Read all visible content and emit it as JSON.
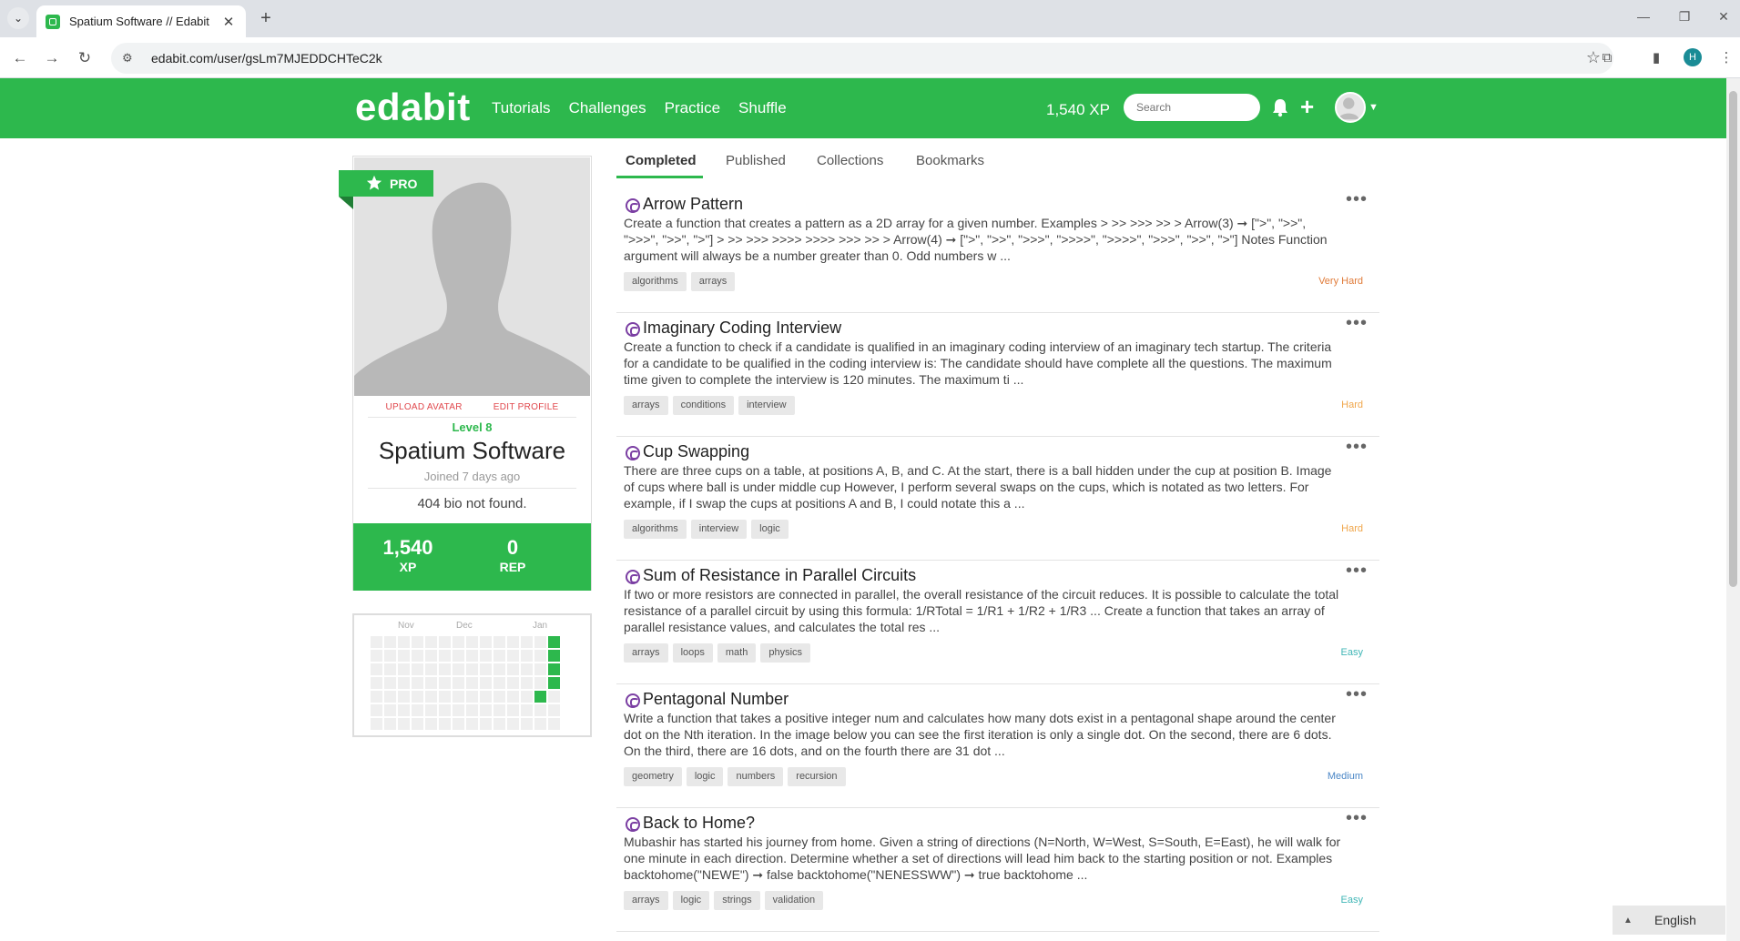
{
  "browser": {
    "tab_title": "Spatium Software // Edabit",
    "url": "edabit.com/user/gsLm7MJEDDCHTeC2k",
    "profile_initial": "H"
  },
  "header": {
    "logo": "edabit",
    "nav": [
      "Tutorials",
      "Challenges",
      "Practice",
      "Shuffle"
    ],
    "xp": "1,540 XP",
    "search_placeholder": "Search"
  },
  "profile": {
    "badge": "PRO",
    "upload_avatar": "UPLOAD AVATAR",
    "edit_profile": "EDIT PROFILE",
    "level": "Level 8",
    "name": "Spatium Software",
    "joined": "Joined 7 days ago",
    "bio": "404 bio not found.",
    "xp_value": "1,540",
    "xp_label": "XP",
    "rep_value": "0",
    "rep_label": "REP"
  },
  "calendar": {
    "months": [
      "Nov",
      "Dec",
      "Jan"
    ],
    "active_cells": [
      [
        13,
        0
      ],
      [
        13,
        1
      ],
      [
        13,
        2
      ],
      [
        13,
        3
      ],
      [
        12,
        4
      ]
    ]
  },
  "tabs": [
    "Completed",
    "Published",
    "Collections",
    "Bookmarks"
  ],
  "challenges": [
    {
      "title": "Arrow Pattern",
      "desc": "Create a function that creates a pattern as a 2D array for a given number. Examples > >> >>> >> > Arrow(3) ➞ [\">\", \">>\", \">>>\", \">>\", \">\"] > >> >>> >>>> >>>> >>> >> > Arrow(4) ➞ [\">\", \">>\", \">>>\", \">>>>\", \">>>>\", \">>>\", \">>\", \">\"] Notes Function argument will always be a number greater than 0. Odd numbers w ...",
      "tags": [
        "algorithms",
        "arrays"
      ],
      "difficulty": "Very Hard",
      "color": "#e07b39"
    },
    {
      "title": "Imaginary Coding Interview",
      "desc": "Create a function to check if a candidate is qualified in an imaginary coding interview of an imaginary tech startup. The criteria for a candidate to be qualified in the coding interview is: The candidate should have complete all the questions. The maximum time given to complete the interview is 120 minutes. The maximum ti ...",
      "tags": [
        "arrays",
        "conditions",
        "interview"
      ],
      "difficulty": "Hard",
      "color": "#f0a64b"
    },
    {
      "title": "Cup Swapping",
      "desc": "There are three cups on a table, at positions A, B, and C. At the start, there is a ball hidden under the cup at position B. Image of cups where ball is under middle cup However, I perform several swaps on the cups, which is notated as two letters. For example, if I swap the cups at positions A and B, I could notate this a ...",
      "tags": [
        "algorithms",
        "interview",
        "logic"
      ],
      "difficulty": "Hard",
      "color": "#f0a64b"
    },
    {
      "title": "Sum of Resistance in Parallel Circuits",
      "desc": "If two or more resistors are connected in parallel, the overall resistance of the circuit reduces. It is possible to calculate the total resistance of a parallel circuit by using this formula: 1/RTotal = 1/R1 + 1/R2 + 1/R3 ... Create a function that takes an array of parallel resistance values, and calculates the total res ...",
      "tags": [
        "arrays",
        "loops",
        "math",
        "physics"
      ],
      "difficulty": "Easy",
      "color": "#3fb6b6"
    },
    {
      "title": "Pentagonal Number",
      "desc": "Write a function that takes a positive integer num and calculates how many dots exist in a pentagonal shape around the center dot on the Nth iteration. In the image below you can see the first iteration is only a single dot. On the second, there are 6 dots. On the third, there are 16 dots, and on the fourth there are 31 dot ...",
      "tags": [
        "geometry",
        "logic",
        "numbers",
        "recursion"
      ],
      "difficulty": "Medium",
      "color": "#4a86c6"
    },
    {
      "title": "Back to Home?",
      "desc": "Mubashir has started his journey from home. Given a string of directions (N=North, W=West, S=South, E=East), he will walk for one minute in each direction. Determine whether a set of directions will lead him back to the starting position or not. Examples backtohome(\"NEWE\") ➞ false backtohome(\"NENESSWW\") ➞ true backtohome ...",
      "tags": [
        "arrays",
        "logic",
        "strings",
        "validation"
      ],
      "difficulty": "Easy",
      "color": "#3fb6b6"
    }
  ],
  "language": "English"
}
